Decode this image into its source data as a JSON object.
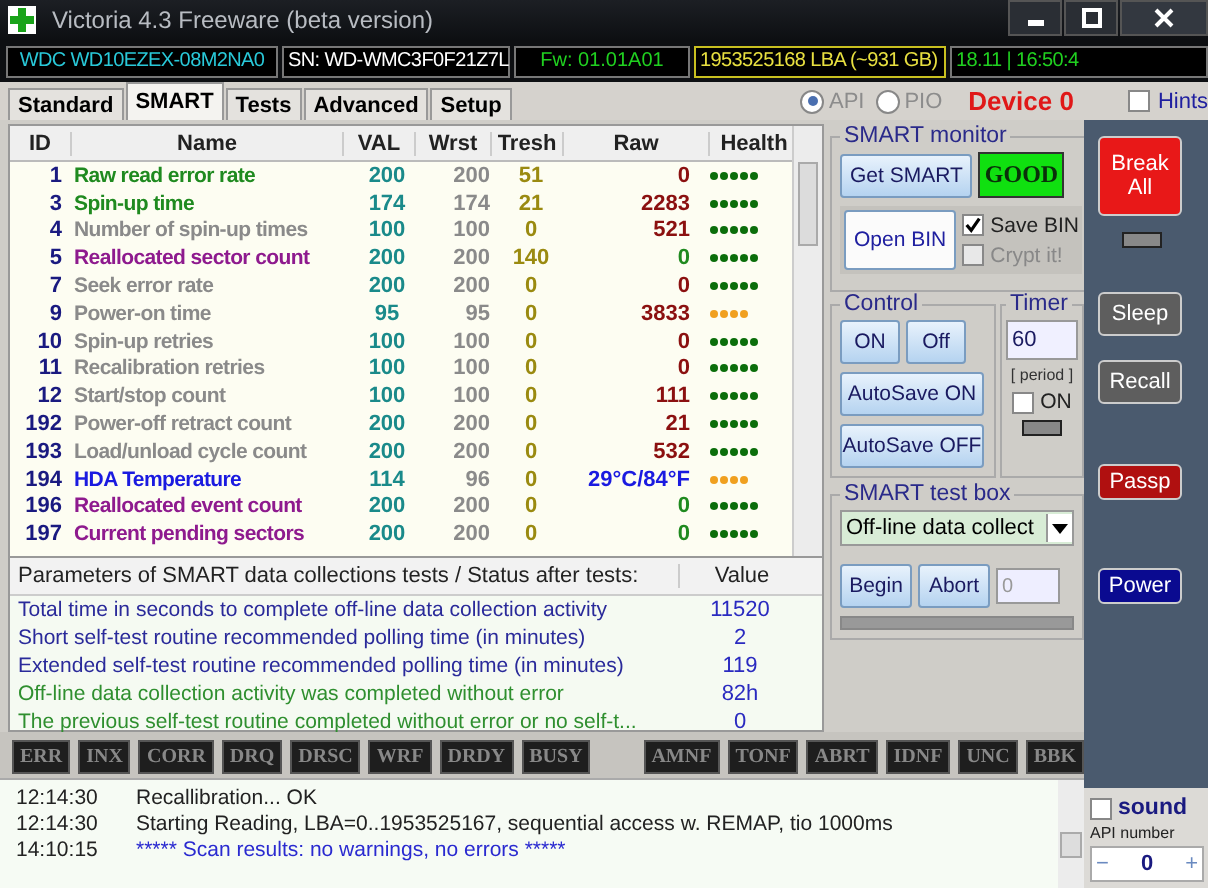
{
  "window": {
    "title": "Victoria 4.3 Freeware (beta version)"
  },
  "info_bar": {
    "model": "WDC WD10EZEX-08M2NA0",
    "serial": "SN: WD-WMC3F0F21Z7L",
    "firmware": "Fw: 01.01A01",
    "capacity": "1953525168 LBA (~931 GB)",
    "clock": "18.11 | 16:50:4"
  },
  "tabs": [
    {
      "label": "Standard",
      "selected": false
    },
    {
      "label": "SMART",
      "selected": true
    },
    {
      "label": "Tests",
      "selected": false
    },
    {
      "label": "Advanced",
      "selected": false
    },
    {
      "label": "Setup",
      "selected": false
    }
  ],
  "mode": [
    {
      "label": "API",
      "selected": true,
      "disabled": true
    },
    {
      "label": "PIO",
      "selected": false,
      "disabled": true
    }
  ],
  "device": "Device 0",
  "hints": {
    "label": "Hints",
    "checked": false
  },
  "smart_table": {
    "columns": [
      "ID",
      "Name",
      "VAL",
      "Wrst",
      "Tresh",
      "Raw",
      "Health"
    ],
    "rows": [
      {
        "id": "1",
        "name": "Raw read error rate",
        "val": "200",
        "wrst": "200",
        "tresh": "51",
        "raw": "0",
        "stars": 5,
        "kind": "primary"
      },
      {
        "id": "3",
        "name": "Spin-up time",
        "val": "174",
        "wrst": "174",
        "tresh": "21",
        "raw": "2283",
        "stars": 5,
        "kind": "primary"
      },
      {
        "id": "4",
        "name": "Number of spin-up times",
        "val": "100",
        "wrst": "100",
        "tresh": "0",
        "raw": "521",
        "stars": 5,
        "kind": "normal"
      },
      {
        "id": "5",
        "name": "Reallocated sector count",
        "val": "200",
        "wrst": "200",
        "tresh": "140",
        "raw": "0",
        "stars": 5,
        "kind": "critical"
      },
      {
        "id": "7",
        "name": "Seek error rate",
        "val": "200",
        "wrst": "200",
        "tresh": "0",
        "raw": "0",
        "stars": 5,
        "kind": "normal"
      },
      {
        "id": "9",
        "name": "Power-on time",
        "val": "95",
        "wrst": "95",
        "tresh": "0",
        "raw": "3833",
        "stars": 4,
        "kind": "normal"
      },
      {
        "id": "10",
        "name": "Spin-up retries",
        "val": "100",
        "wrst": "100",
        "tresh": "0",
        "raw": "0",
        "stars": 5,
        "kind": "normal"
      },
      {
        "id": "11",
        "name": "Recalibration retries",
        "val": "100",
        "wrst": "100",
        "tresh": "0",
        "raw": "0",
        "stars": 5,
        "kind": "normal"
      },
      {
        "id": "12",
        "name": "Start/stop count",
        "val": "100",
        "wrst": "100",
        "tresh": "0",
        "raw": "111",
        "stars": 5,
        "kind": "normal"
      },
      {
        "id": "192",
        "name": "Power-off retract count",
        "val": "200",
        "wrst": "200",
        "tresh": "0",
        "raw": "21",
        "stars": 5,
        "kind": "normal"
      },
      {
        "id": "193",
        "name": "Load/unload cycle count",
        "val": "200",
        "wrst": "200",
        "tresh": "0",
        "raw": "532",
        "stars": 5,
        "kind": "normal"
      },
      {
        "id": "194",
        "name": "HDA Temperature",
        "val": "114",
        "wrst": "96",
        "tresh": "0",
        "raw": "29°C/84°F",
        "stars": 4,
        "kind": "temp"
      },
      {
        "id": "196",
        "name": "Reallocated event count",
        "val": "200",
        "wrst": "200",
        "tresh": "0",
        "raw": "0",
        "stars": 5,
        "kind": "critical"
      },
      {
        "id": "197",
        "name": "Current pending sectors",
        "val": "200",
        "wrst": "200",
        "tresh": "0",
        "raw": "0",
        "stars": 5,
        "kind": "critical"
      }
    ]
  },
  "params_table": {
    "columns": [
      "Parameters of SMART data collections tests / Status after tests:",
      "Value"
    ],
    "rows": [
      {
        "text": "Total time in seconds to complete off-line data collection activity",
        "value": "11520",
        "kind": "info"
      },
      {
        "text": "Short self-test routine recommended polling time (in minutes)",
        "value": "2",
        "kind": "info"
      },
      {
        "text": "Extended self-test routine recommended polling time (in minutes)",
        "value": "119",
        "kind": "info"
      },
      {
        "text": "Off-line data collection activity was completed without error",
        "value": "82h",
        "kind": "status"
      },
      {
        "text": "The previous self-test routine completed without error or no self-t...",
        "value": "0",
        "kind": "status"
      }
    ]
  },
  "smart_monitor": {
    "title": "SMART monitor",
    "get_button": "Get SMART",
    "status": "GOOD",
    "open_button": "Open BIN",
    "save_bin": {
      "label": "Save BIN",
      "checked": true,
      "disabled": false
    },
    "crypt": {
      "label": "Crypt it!",
      "checked": false,
      "disabled": true
    }
  },
  "control": {
    "title": "Control",
    "buttons": [
      "ON",
      "Off",
      "AutoSave ON",
      "AutoSave OFF"
    ]
  },
  "timer": {
    "title": "Timer",
    "value": "60",
    "caption": "[ period ]",
    "enable": {
      "label": "ON",
      "checked": false
    }
  },
  "test_box": {
    "title": "SMART test box",
    "selection": "Off-line data collect",
    "buttons": [
      "Begin",
      "Abort"
    ],
    "count": "0",
    "level": 0
  },
  "side_buttons": [
    {
      "label": "Break All",
      "kind": "red"
    },
    {
      "kind": "led"
    },
    {
      "label": "Sleep",
      "kind": "gray"
    },
    {
      "label": "Recall",
      "kind": "gray"
    },
    {
      "label": "Passp",
      "kind": "darkred"
    },
    {
      "label": "Power",
      "kind": "blue"
    }
  ],
  "flags_left": [
    "ERR",
    "INX",
    "CORR",
    "DRQ",
    "DRSC",
    "WRF",
    "DRDY",
    "BUSY"
  ],
  "flags_right": [
    "AMNF",
    "TONF",
    "ABRT",
    "IDNF",
    "UNC",
    "BBK"
  ],
  "log": [
    {
      "time": "12:14:30",
      "text": "Recallibration... OK",
      "kind": "normal"
    },
    {
      "time": "12:14:30",
      "text": "Starting Reading, LBA=0..1953525167, sequential access w. REMAP, tio 1000ms",
      "kind": "normal"
    },
    {
      "time": "14:10:15",
      "text": "***** Scan results: no warnings, no errors *****",
      "kind": "result"
    }
  ],
  "sound": {
    "label": "sound",
    "checked": false
  },
  "api_number": {
    "label": "API number",
    "value": "0",
    "minus": "−",
    "plus": "+"
  }
}
